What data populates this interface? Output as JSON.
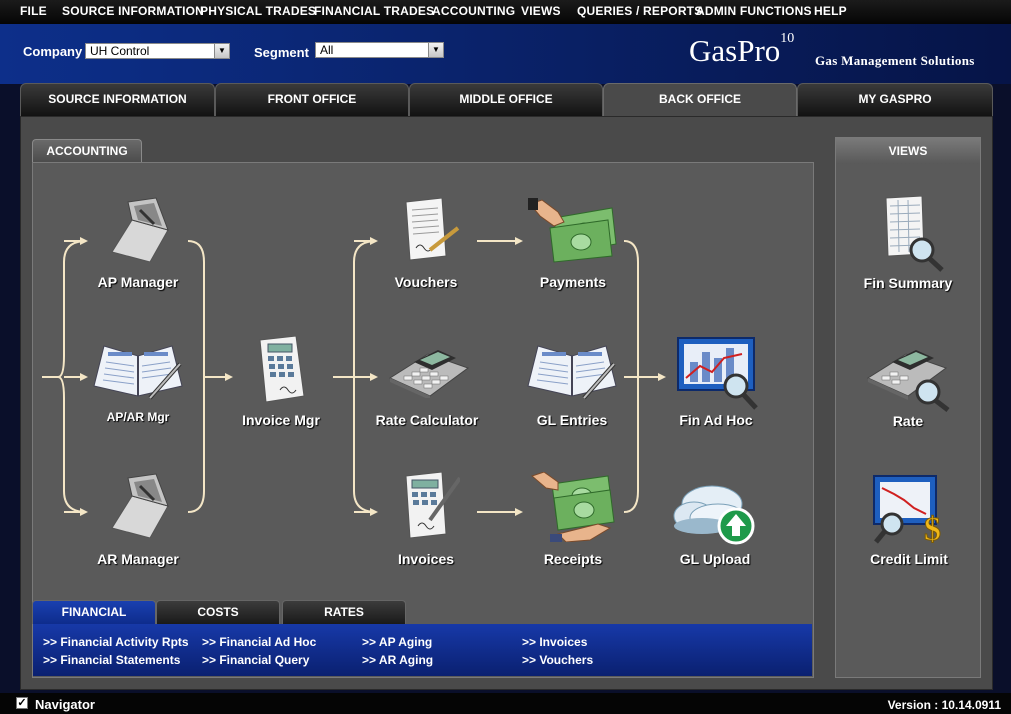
{
  "menu": [
    "FILE",
    "SOURCE INFORMATION",
    "PHYSICAL TRADES",
    "FINANCIAL TRADES",
    "ACCOUNTING",
    "VIEWS",
    "QUERIES / REPORTS",
    "ADMIN FUNCTIONS",
    "HELP"
  ],
  "header": {
    "company_label": "Company",
    "company_value": "UH Control",
    "segment_label": "Segment",
    "segment_value": "All",
    "logo_text": "GasPro",
    "logo_sup": "10",
    "tagline": "Gas Management Solutions"
  },
  "tabs": [
    "SOURCE INFORMATION",
    "FRONT OFFICE",
    "MIDDLE OFFICE",
    "BACK OFFICE",
    "MY GASPRO"
  ],
  "active_tab": "BACK OFFICE",
  "section_tab": "ACCOUNTING",
  "flow": {
    "ap_manager": "AP Manager",
    "apar_mgr": "AP/AR Mgr",
    "ar_manager": "AR Manager",
    "invoice_mgr": "Invoice Mgr",
    "vouchers": "Vouchers",
    "rate_calculator": "Rate Calculator",
    "invoices": "Invoices",
    "payments": "Payments",
    "gl_entries": "GL Entries",
    "receipts": "Receipts",
    "fin_ad_hoc": "Fin Ad Hoc",
    "gl_upload": "GL Upload"
  },
  "views": {
    "title": "VIEWS",
    "fin_summary": "Fin Summary",
    "rate": "Rate",
    "credit_limit": "Credit Limit"
  },
  "bottom_tabs": [
    "FINANCIAL",
    "COSTS",
    "RATES"
  ],
  "links": [
    [
      ">> Financial Activity Rpts",
      ">> Financial Statements"
    ],
    [
      ">> Financial Ad Hoc",
      ">> Financial Query"
    ],
    [
      ">> AP Aging",
      ">> AR Aging"
    ],
    [
      ">> Invoices",
      ">> Vouchers"
    ]
  ],
  "status": {
    "navigator_label": "Navigator",
    "navigator_checked": true,
    "version": "Version : 10.14.0911"
  },
  "colors": {
    "accent_blue": "#0d2f8a",
    "panel_gray": "#5a5a5a",
    "arrow_color": "#f4e6c6"
  }
}
